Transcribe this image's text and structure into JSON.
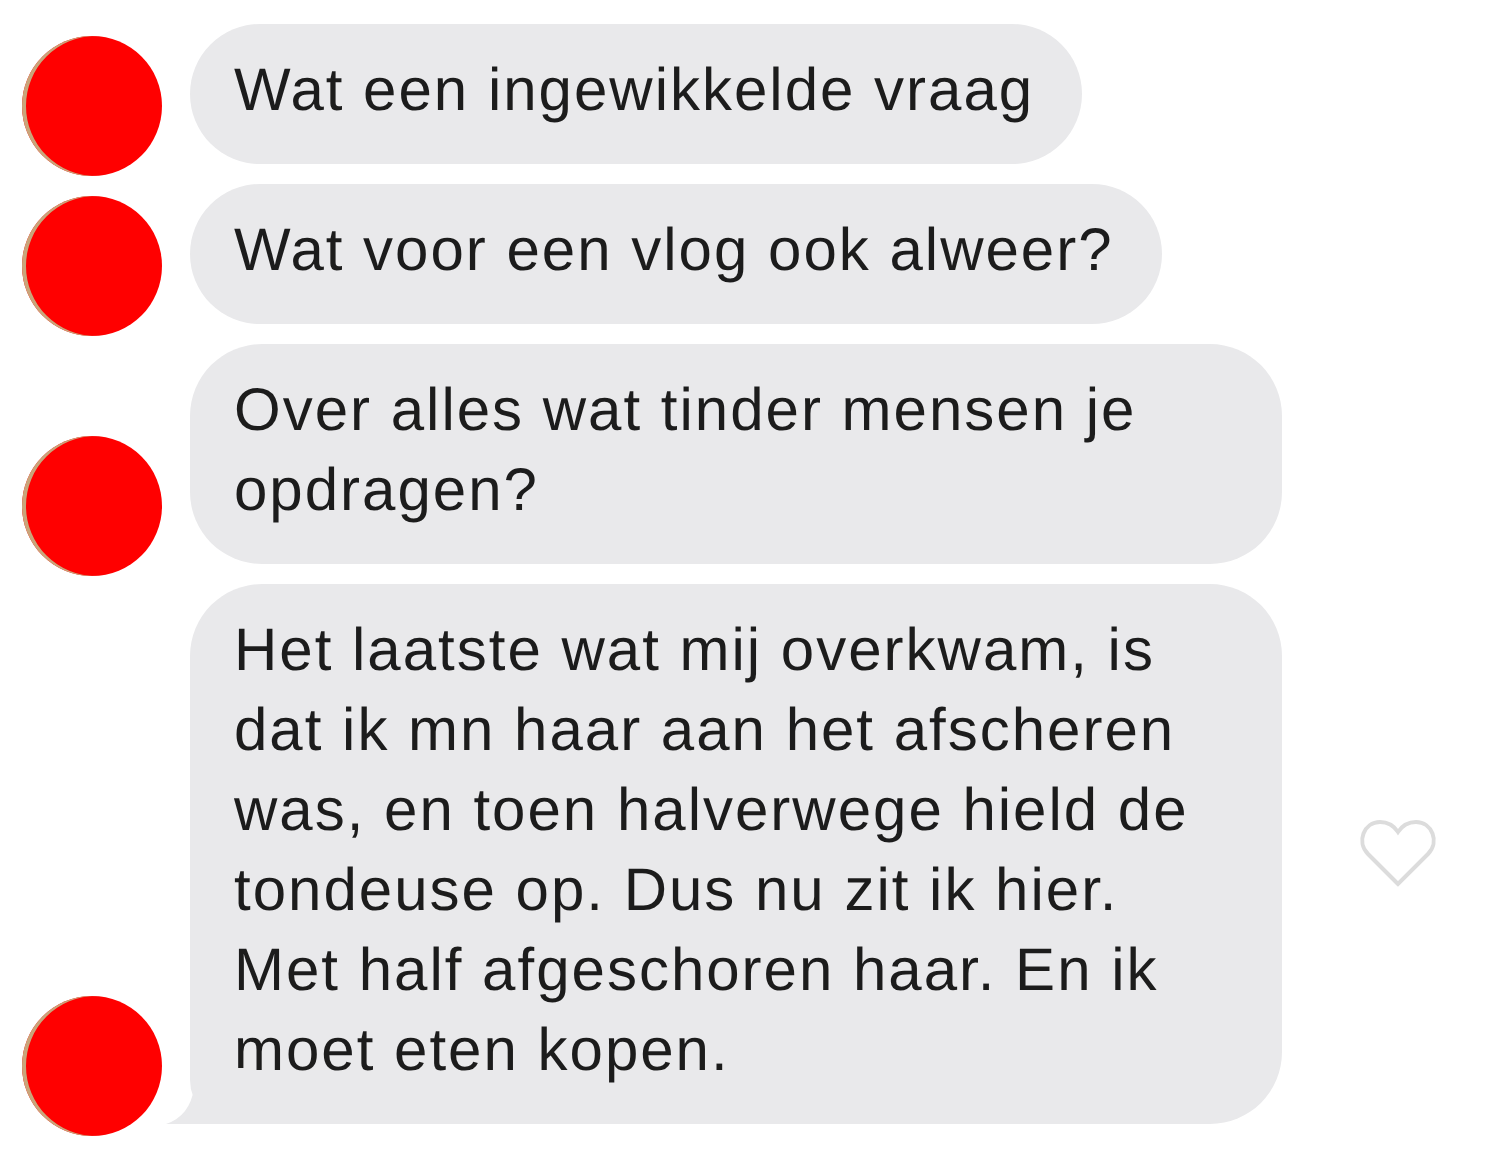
{
  "messages": [
    {
      "text": "Wat een ingewikkelde vraag",
      "tail": false,
      "heart": false
    },
    {
      "text": "Wat voor een vlog ook alweer?",
      "tail": false,
      "heart": false
    },
    {
      "text": "Over alles wat tinder mensen je opdragen?",
      "tail": false,
      "heart": false
    },
    {
      "text": "Het laatste wat mij overkwam, is dat ik mn haar aan het afscheren was, en toen halverwege hield de tondeuse op. Dus nu zit ik hier. Met half afgeschoren haar. En ik moet eten kopen.",
      "tail": true,
      "heart": true
    }
  ]
}
